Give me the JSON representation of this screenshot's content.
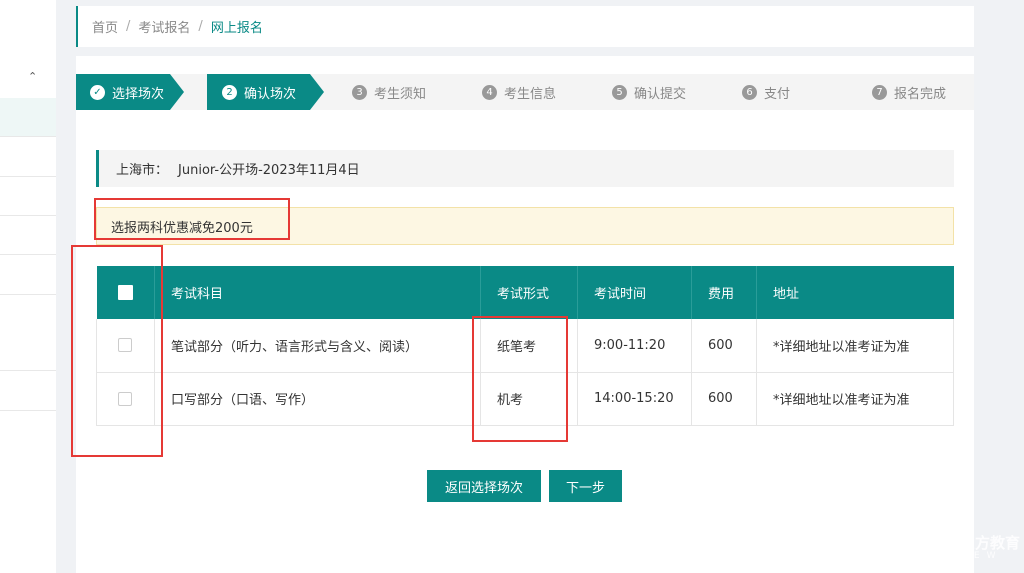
{
  "sidebar": {
    "collapse_icon": "chevron-up-icon",
    "collapse_glyph": "⌃"
  },
  "breadcrumb": {
    "items": [
      "首页",
      "考试报名",
      "网上报名"
    ],
    "separator": "/"
  },
  "steps": [
    {
      "num": "✓",
      "label": "选择场次",
      "state": "done"
    },
    {
      "num": "2",
      "label": "确认场次",
      "state": "active"
    },
    {
      "num": "3",
      "label": "考生须知",
      "state": "pending"
    },
    {
      "num": "4",
      "label": "考生信息",
      "state": "pending"
    },
    {
      "num": "5",
      "label": "确认提交",
      "state": "pending"
    },
    {
      "num": "6",
      "label": "支付",
      "state": "pending"
    },
    {
      "num": "7",
      "label": "报名完成",
      "state": "pending"
    }
  ],
  "venue": {
    "label": "上海市：",
    "value": "Junior-公开场-2023年11月4日"
  },
  "notice": {
    "text": "选报两科优惠减免200元"
  },
  "table": {
    "headers": [
      "考试科目",
      "考试形式",
      "考试时间",
      "费用",
      "地址"
    ],
    "rows": [
      {
        "subject": "笔试部分（听力、语言形式与含义、阅读）",
        "format": "纸笔考",
        "time": "9:00-11:20",
        "fee": "600",
        "address": "*详细地址以准考证为准"
      },
      {
        "subject": "口写部分（口语、写作）",
        "format": "机考",
        "time": "14:00-15:20",
        "fee": "600",
        "address": "*详细地址以准考证为准"
      }
    ]
  },
  "buttons": {
    "back": "返回选择场次",
    "next": "下一步"
  },
  "watermark": {
    "title": "新东方教育",
    "sub": "XNEW"
  },
  "colors": {
    "accent": "#0a8a86",
    "annotation": "#e53935",
    "notice_bg": "#fdf7e3"
  }
}
